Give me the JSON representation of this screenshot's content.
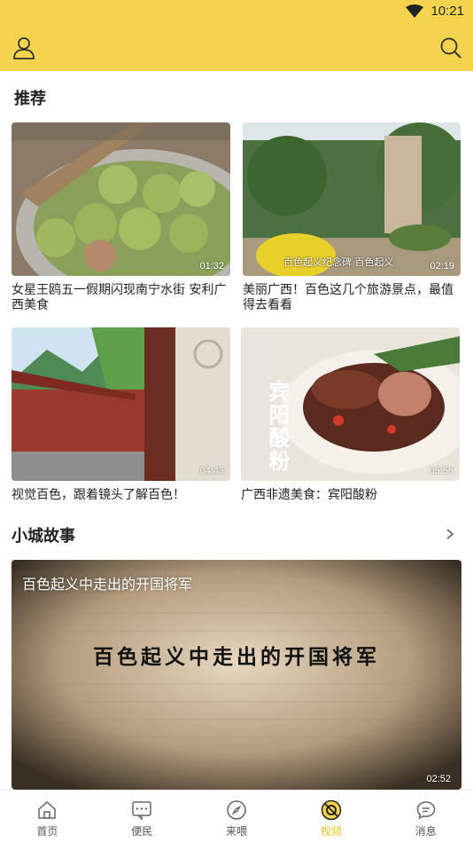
{
  "status": {
    "time": "10:21"
  },
  "sections": {
    "recommend": "推荐",
    "town_stories": "小城故事"
  },
  "recommend_items": [
    {
      "caption": "女星王鸥五一假期闪现南宁水街 安利广西美食",
      "duration": "01:32"
    },
    {
      "caption": "美丽广西！百色这几个旅游景点，最值得去看看",
      "duration": "02:19",
      "overlay": "百色起义纪念碑 百色起义"
    },
    {
      "caption": "视觉百色，跟着镜头了解百色！",
      "duration": "04:43"
    },
    {
      "caption": "广西非遗美食：宾阳酸粉",
      "duration": "05:55",
      "overlay": "宾阳酸粉"
    }
  ],
  "featured": {
    "title": "百色起义中走出的开国将军",
    "center_text": "百色起义中走出的开国将军",
    "duration": "02:52"
  },
  "tabs": [
    {
      "label": "首页",
      "icon": "home-icon",
      "active": false
    },
    {
      "label": "便民",
      "icon": "chat-icon",
      "active": false
    },
    {
      "label": "来喂",
      "icon": "compass-icon",
      "active": false
    },
    {
      "label": "视频",
      "icon": "video-icon",
      "active": true
    },
    {
      "label": "消息",
      "icon": "message-icon",
      "active": false
    }
  ],
  "colors": {
    "accent": "#f4d44c",
    "active_tab": "#e8c22a"
  }
}
